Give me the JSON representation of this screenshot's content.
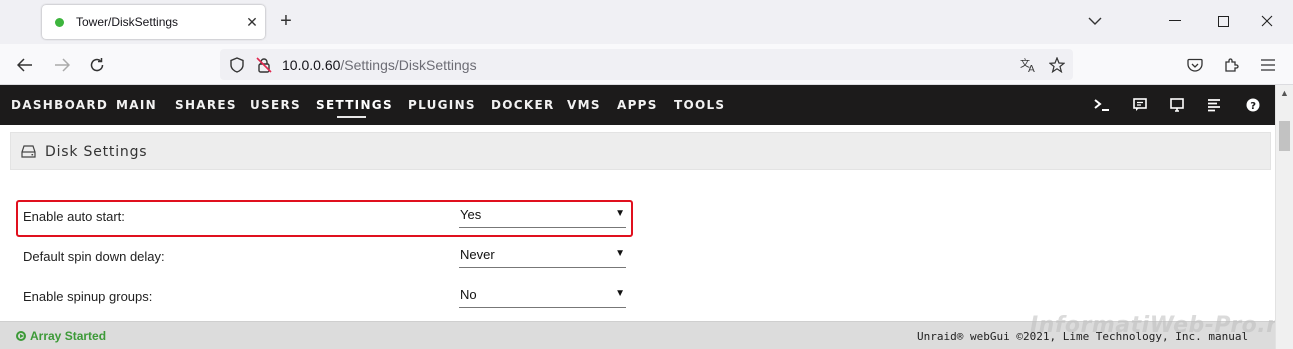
{
  "browser": {
    "tab_title": "Tower/DiskSettings",
    "new_tab_label": "+",
    "url_host": "10.0.0.60",
    "url_path": "/Settings/DiskSettings"
  },
  "menu": {
    "items": [
      {
        "label": "DASHBOARD"
      },
      {
        "label": "MAIN"
      },
      {
        "label": "SHARES"
      },
      {
        "label": "USERS"
      },
      {
        "label": "SETTINGS",
        "active": true
      },
      {
        "label": "PLUGINS"
      },
      {
        "label": "DOCKER"
      },
      {
        "label": "VMS"
      },
      {
        "label": "APPS"
      },
      {
        "label": "TOOLS"
      }
    ],
    "icons": [
      "terminal-icon",
      "feedback-icon",
      "display-icon",
      "log-icon",
      "help-icon"
    ]
  },
  "page": {
    "section_title": "Disk Settings",
    "settings": [
      {
        "label": "Enable auto start:",
        "value": "Yes"
      },
      {
        "label": "Default spin down delay:",
        "value": "Never"
      },
      {
        "label": "Enable spinup groups:",
        "value": "No"
      }
    ]
  },
  "footer": {
    "status": "Array Started",
    "copyright": "Unraid® webGui ©2021, Lime Technology, Inc. manual",
    "watermark": "InformatiWeb-Pro.net"
  },
  "colors": {
    "menu_bg": "#1c1b1b",
    "status_green": "#3d9a38",
    "highlight_red": "#e0101e"
  }
}
